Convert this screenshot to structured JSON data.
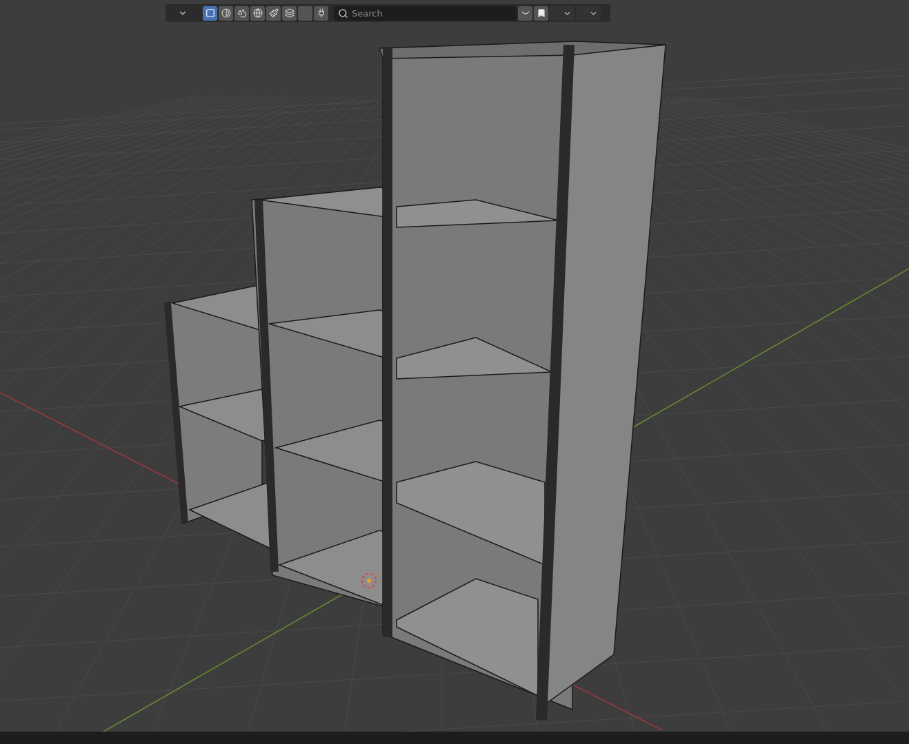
{
  "toolbar": {
    "filters": [
      {
        "kind": "select",
        "selected": true
      },
      {
        "kind": "shading",
        "selected": false
      },
      {
        "kind": "material",
        "selected": false
      },
      {
        "kind": "world",
        "selected": false
      },
      {
        "kind": "paint",
        "selected": false
      },
      {
        "kind": "data",
        "selected": false
      },
      {
        "kind": "empty",
        "selected": false
      },
      {
        "kind": "plugin",
        "selected": false
      }
    ],
    "search": {
      "placeholder": "Search"
    }
  }
}
